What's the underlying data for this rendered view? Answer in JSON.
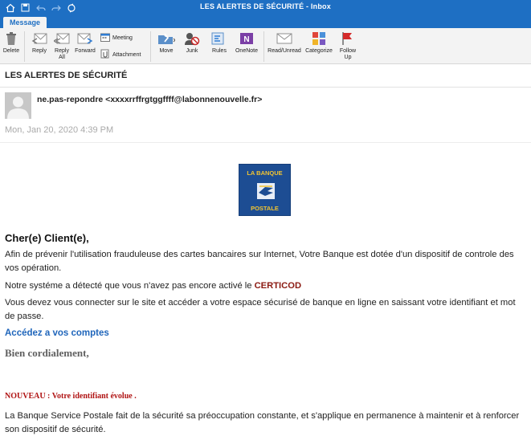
{
  "window": {
    "title": "LES ALERTES DE SÉCURITÉ - Inbox"
  },
  "tabs": {
    "message": "Message"
  },
  "ribbon": {
    "delete": "Delete",
    "reply": "Reply",
    "reply_all_1": "Reply",
    "reply_all_2": "All",
    "forward": "Forward",
    "meeting": "Meeting",
    "attachment": "Attachment",
    "move": "Move",
    "junk": "Junk",
    "rules": "Rules",
    "onenote": "OneNote",
    "read_unread": "Read/Unread",
    "categorize": "Categorize",
    "follow_up_1": "Follow",
    "follow_up_2": "Up"
  },
  "email": {
    "subject": "LES ALERTES DE SÉCURITÉ",
    "sender": "ne.pas-repondre <xxxxrrffrgtggffff@labonnenouvelle.fr>",
    "date": "Mon, Jan 20, 2020 4:39 PM"
  },
  "logo": {
    "line1": "LA BANQUE",
    "line2": "POSTALE"
  },
  "body": {
    "greeting": "Cher(e) Client(e),",
    "p1": "Afin de prévenir l'utilisation frauduleuse des cartes bancaires sur Internet, Votre Banque est dotée d'un dispositif de controle des vos opération.",
    "p2_prefix": "Notre systéme a détecté que vous n'avez pas encore activé le ",
    "p2_highlight": "CERTICOD",
    "p3": "Vous devez vous connecter sur le site et accéder a votre espace sécurisé de banque en ligne en saissant votre identifiant et mot de passe.",
    "link": "Accédez a vos comptes",
    "closing": "Bien cordialement,",
    "notice": "NOUVEAU : Votre identifiant évolue .",
    "p4": "La Banque Service Postale fait de la sécurité sa préoccupation constante, et s'applique en permanence à maintenir et à renforcer son dispositif de sécurité."
  },
  "colors": {
    "titlebar": "#1e6fc3",
    "link": "#2066bb",
    "highlight": "#8b1a12",
    "notice": "#b01313",
    "logo_bg": "#1d4d93",
    "logo_text": "#f2c431"
  }
}
